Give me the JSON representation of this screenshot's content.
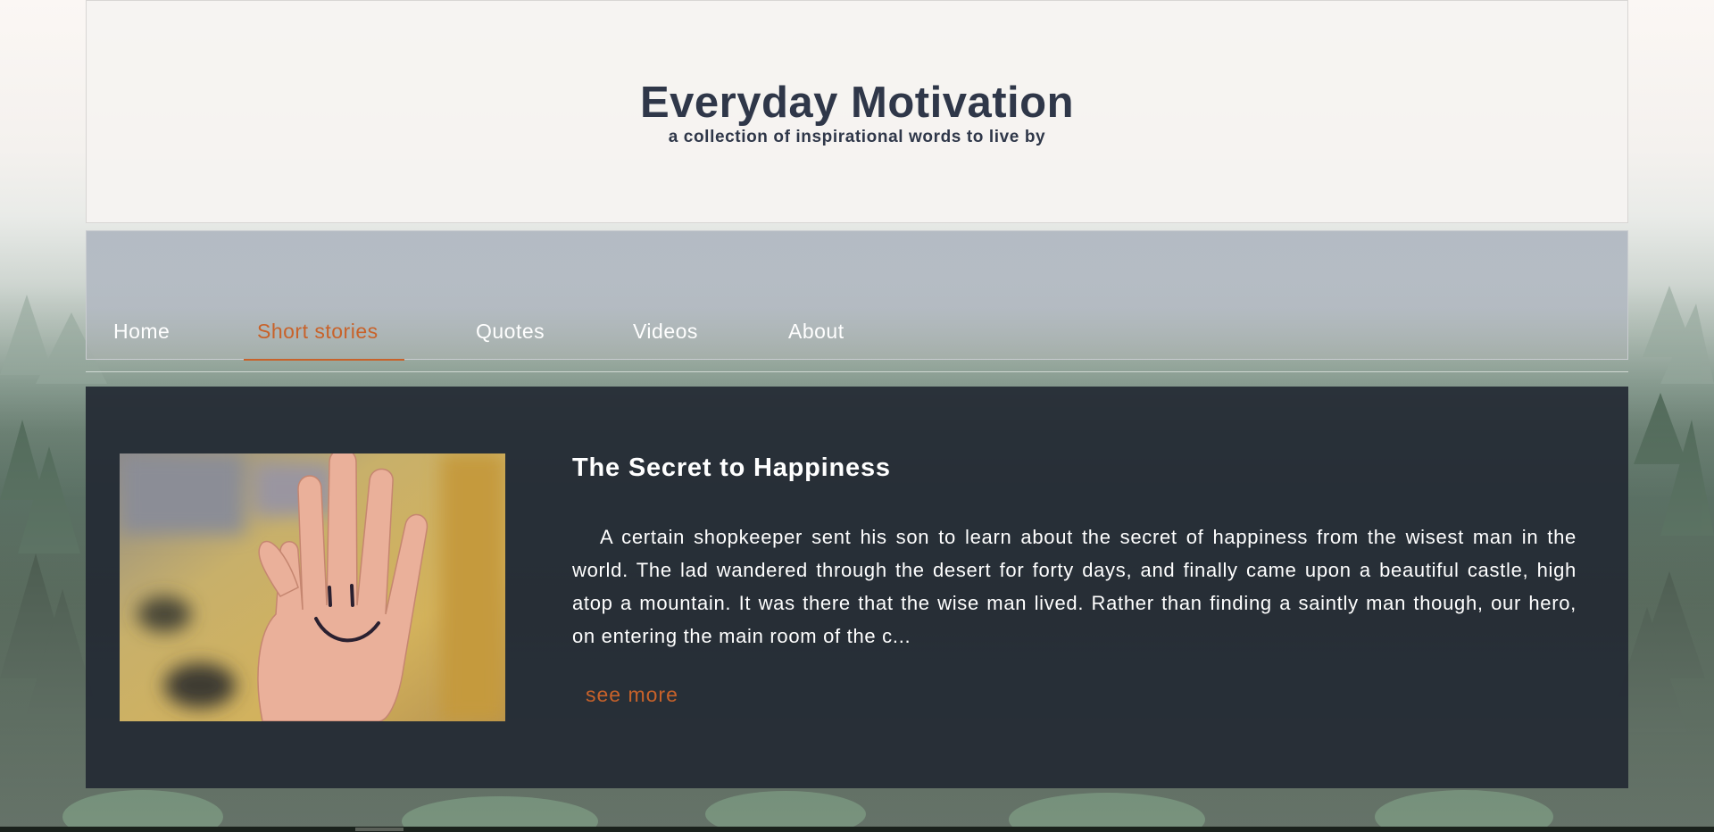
{
  "site": {
    "title": "Everyday Motivation",
    "subtitle": "a collection of inspirational words to live by"
  },
  "nav": {
    "items": [
      {
        "label": "Home",
        "active": false
      },
      {
        "label": "Short stories",
        "active": true
      },
      {
        "label": "Quotes",
        "active": false
      },
      {
        "label": "Videos",
        "active": false
      },
      {
        "label": "About",
        "active": false
      }
    ]
  },
  "story": {
    "title": "The Secret to Happiness",
    "excerpt": "A certain shopkeeper sent his son to learn about the secret of happiness from the wisest man in the world. The lad wandered through the desert for forty days, and finally came upon a beautiful castle, high atop a mountain. It was there that the wise man lived. Rather than finding a saintly man though, our hero, on entering the main room of the c...",
    "see_more": "see more",
    "image_icon": "smiley-hand-photo"
  },
  "colors": {
    "accent": "#c8622a",
    "title_text": "#2f3749",
    "card_bg": "#242a34"
  }
}
